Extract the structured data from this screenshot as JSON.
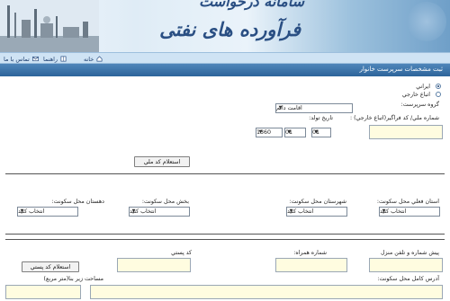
{
  "banner": {
    "title_line1": "سامانه درخواست",
    "title_line2": "فرآورده های نفتی"
  },
  "nav": {
    "home_label": "خانه",
    "help_label": "راهنما",
    "contact_label": "تماس با ما"
  },
  "section": {
    "title": "ثبت مشخصات سرپرست خانوار"
  },
  "nationality": {
    "iranian_label": "ايراني",
    "foreign_label": "اتباع خارجي",
    "selected": "iranian"
  },
  "group_label": "گروه سرپرست:",
  "group_select": {
    "value": "اقامت دائم"
  },
  "national_id_label": "شماره ملي/ كد فراگير(اتباع خارجي) :",
  "birth_date_label": "تاريخ تولد:",
  "birth_date": {
    "day": "01",
    "month": "01",
    "year": "1360"
  },
  "inquiry_button": "استعلام كد ملي",
  "location": {
    "province_label": "استان فعلي محل سكونت:",
    "county_label": "شهرستان محل سكونت:",
    "district_label": "بخش محل سكونت:",
    "rural_label": "دهستان محل سكونت:",
    "select_placeholder": "انتخاب كنيد"
  },
  "contact": {
    "phone_label": "پيش شماره و تلفن منزل",
    "mobile_label": "شماره همراه:",
    "postal_label": "كد پستي",
    "postal_inquiry_button": "استعلام كد پستي",
    "address_label": "آدرس كامل محل سكونت:",
    "area_label": "مساحت زير بنا(متر مربع)"
  },
  "icons": {
    "home": "house-icon",
    "help": "book-icon",
    "contact": "envelope-icon"
  }
}
